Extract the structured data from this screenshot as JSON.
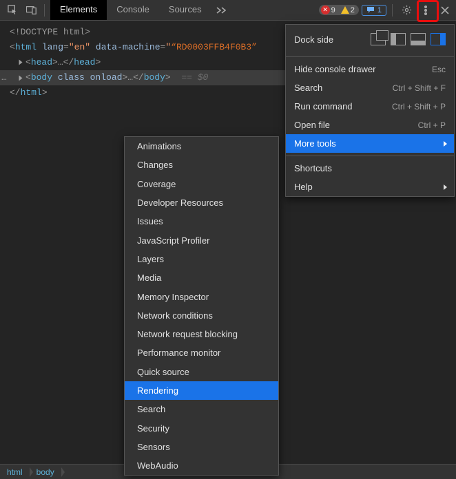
{
  "toolbar": {
    "tabs": [
      "Elements",
      "Console",
      "Sources"
    ],
    "active_tab": 0,
    "errors": "9",
    "warnings": "2",
    "messages": "1"
  },
  "dom": {
    "doctype": "<!DOCTYPE html>",
    "html_open_prefix": "<html ",
    "html_lang_attr": "lang",
    "html_lang_val": "\"en\"",
    "html_machine_attr": "data-machine",
    "html_machine_val_open": "\"",
    "html_machine_val": "“RD0003FFB4F0B3”",
    "head_open": "<head>",
    "head_ellipsis": "…",
    "head_close": "</head>",
    "body_open": "<body ",
    "body_attrs": "class onload",
    "body_close_open": ">",
    "body_ellipsis": "…",
    "body_close": "</body>",
    "selected_hint": "== $0",
    "html_close": "</html>"
  },
  "breadcrumb": [
    "html",
    "body"
  ],
  "menu": {
    "dock_label": "Dock side",
    "items": [
      {
        "label": "Hide console drawer",
        "shortcut": "Esc"
      },
      {
        "label": "Search",
        "shortcut": "Ctrl + Shift + F"
      },
      {
        "label": "Run command",
        "shortcut": "Ctrl + Shift + P"
      },
      {
        "label": "Open file",
        "shortcut": "Ctrl + P"
      },
      {
        "label": "More tools",
        "submenu": true,
        "hover": true
      },
      {
        "sep": true
      },
      {
        "label": "Shortcuts"
      },
      {
        "label": "Help",
        "submenu": true
      }
    ]
  },
  "submenu": {
    "items": [
      "Animations",
      "Changes",
      "Coverage",
      "Developer Resources",
      "Issues",
      "JavaScript Profiler",
      "Layers",
      "Media",
      "Memory Inspector",
      "Network conditions",
      "Network request blocking",
      "Performance monitor",
      "Quick source",
      "Rendering",
      "Search",
      "Security",
      "Sensors",
      "WebAudio"
    ],
    "hover_index": 13
  }
}
